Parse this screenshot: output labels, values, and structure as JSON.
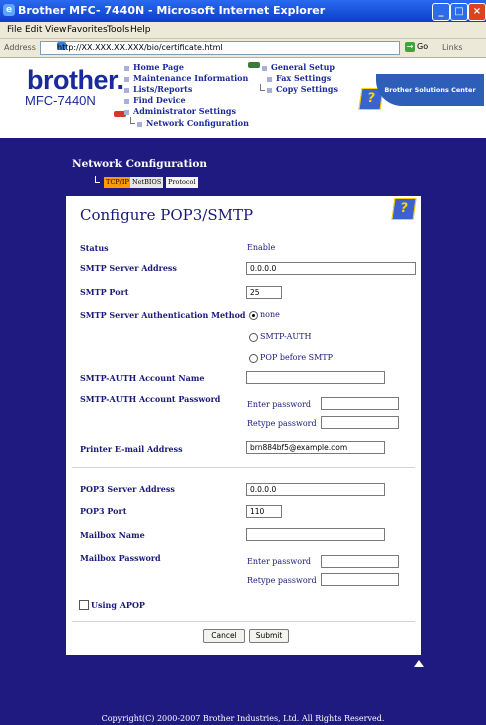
{
  "window": {
    "title": "Brother MFC- 7440N  - Microsoft Internet Explorer"
  },
  "menu": [
    "File",
    "Edit",
    "View",
    "Favorites",
    "Tools",
    "Help"
  ],
  "address": {
    "label": "Address",
    "url": "http://XX.XXX.XX.XXX/bio/certificate.html",
    "go_label": "Go",
    "links_label": "Links"
  },
  "brand": {
    "logo": "brother.",
    "model": "MFC-7440N"
  },
  "nav": {
    "left": [
      "Home Page",
      "Maintenance Information",
      "Lists/Reports",
      "Find Device",
      "Administrator Settings",
      "Network Configuration"
    ],
    "right": [
      "General Setup",
      "Fax Settings",
      "Copy Settings"
    ]
  },
  "solutions_center": "Brother Solutions Center",
  "help_icon_glyph": "?",
  "section": {
    "title": "Network Configuration"
  },
  "tabs": [
    "TCP/IP",
    "NetBIOS",
    "Protocol"
  ],
  "page": {
    "title": "Configure POP3/SMTP"
  },
  "fields": {
    "status": {
      "label": "Status",
      "value": "Enable"
    },
    "smtp_server": {
      "label": "SMTP Server Address",
      "value": "0.0.0.0"
    },
    "smtp_port": {
      "label": "SMTP Port",
      "value": "25"
    },
    "smtp_auth": {
      "label": "SMTP Server Authentication Method",
      "options": [
        "none",
        "SMTP-AUTH",
        "POP before SMTP"
      ],
      "selected": "none"
    },
    "smtp_auth_name": {
      "label": "SMTP-AUTH Account Name",
      "value": ""
    },
    "smtp_auth_password": {
      "label": "SMTP-AUTH Account Password",
      "enter": "Enter password",
      "retype": "Retype password"
    },
    "printer_email": {
      "label": "Printer E-mail Address",
      "value": "brn884bf5@example.com"
    },
    "pop3_server": {
      "label": "POP3 Server Address",
      "value": "0.0.0.0"
    },
    "pop3_port": {
      "label": "POP3 Port",
      "value": "110"
    },
    "mailbox_name": {
      "label": "Mailbox Name",
      "value": ""
    },
    "mailbox_password": {
      "label": "Mailbox Password",
      "enter": "Enter password",
      "retype": "Retype password"
    },
    "apop": {
      "label": "Using APOP",
      "checked": false
    }
  },
  "buttons": {
    "cancel": "Cancel",
    "submit": "Submit"
  },
  "footer": "Copyright(C) 2000-2007 Brother Industries, Ltd. All Rights Reserved."
}
